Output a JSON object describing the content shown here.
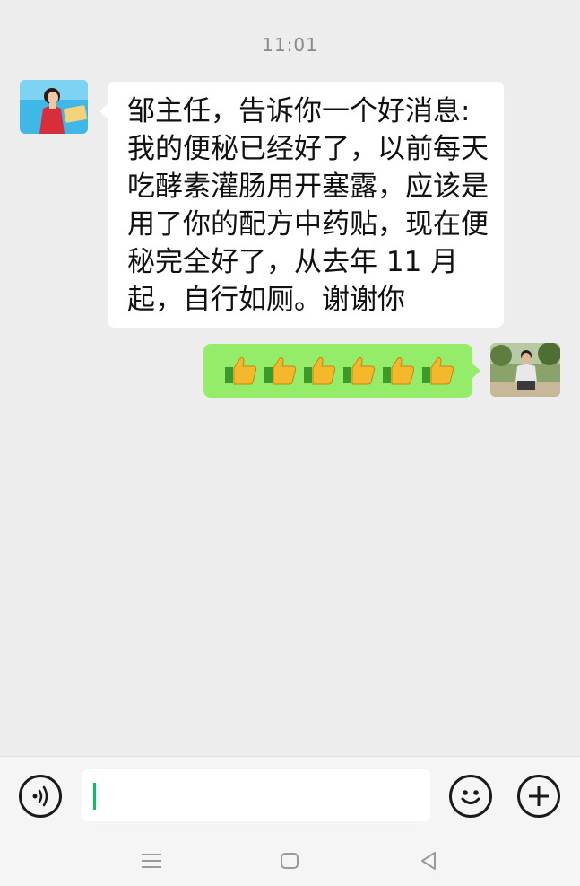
{
  "timestamp": "11:01",
  "messages": [
    {
      "side": "left",
      "avatar": "woman-speaker-avatar",
      "text": "邹主任，告诉你一个好消息:我的便秘已经好了，以前每天吃酵素灌肠用开塞露，应该是用了你的配方中药贴，现在便秘完全好了，从去年 11 月起，自行如厕。谢谢你"
    },
    {
      "side": "right",
      "avatar": "man-outdoor-avatar",
      "emoji": "thumbs-up",
      "emoji_count": 6
    }
  ],
  "input_bar": {
    "voice_icon": "voice-icon",
    "emoji_icon": "emoji-smile-icon",
    "plus_icon": "plus-icon",
    "text_value": ""
  },
  "nav_bar": {
    "menu_icon": "menu-lines-icon",
    "home_icon": "home-square-icon",
    "back_icon": "back-triangle-icon"
  },
  "colors": {
    "background": "#ededed",
    "bubble_left": "#ffffff",
    "bubble_right": "#95ec69",
    "caret": "#07c160"
  }
}
